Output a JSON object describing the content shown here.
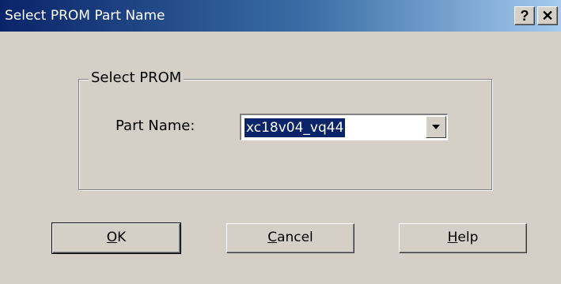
{
  "window": {
    "title": "Select PROM Part Name",
    "help_glyph": "?",
    "close_glyph": "✕"
  },
  "group": {
    "legend": "Select PROM"
  },
  "part_name": {
    "label": "Part Name:",
    "value": "xc18v04_vq44"
  },
  "buttons": {
    "ok": {
      "mnemonic": "O",
      "rest": "K"
    },
    "cancel": {
      "mnemonic": "C",
      "rest": "ancel"
    },
    "help": {
      "mnemonic": "H",
      "rest": "elp"
    }
  },
  "colors": {
    "title_start": "#0a246a",
    "title_end": "#a6caf0",
    "face": "#d4d0c8",
    "selection": "#0a246a"
  }
}
